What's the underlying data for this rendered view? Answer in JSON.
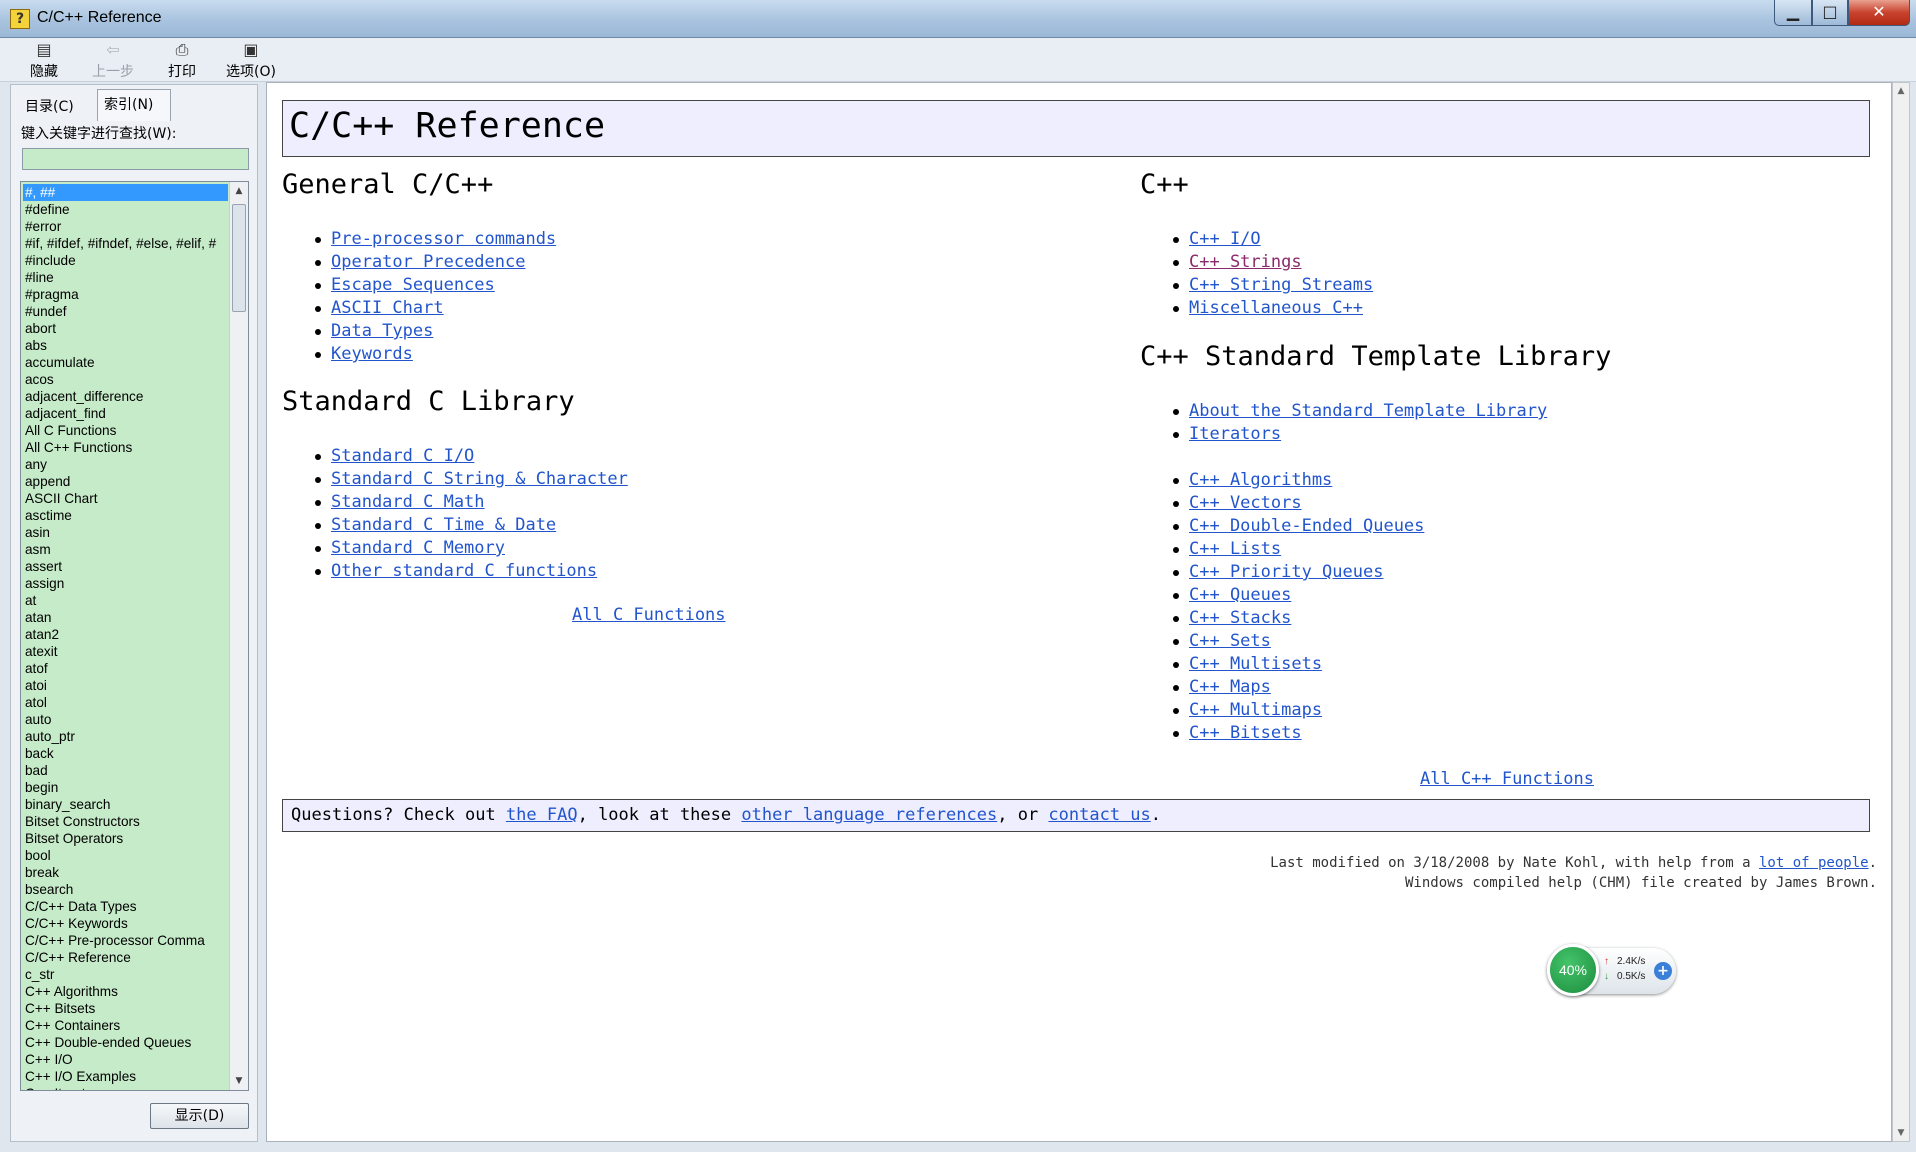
{
  "window": {
    "title": "C/C++ Reference"
  },
  "toolbar": {
    "hide": "隐藏",
    "back": "上一步",
    "print": "打印",
    "options": "选项(O)"
  },
  "sidebar": {
    "tab_contents": "目录(C)",
    "tab_index": "索引(N)",
    "search_label": "键入关键字进行查找(W):",
    "search_value": "",
    "display_button": "显示(D)",
    "keywords": [
      "#, ##",
      "#define",
      "#error",
      "#if, #ifdef, #ifndef, #else, #elif, #",
      "#include",
      "#line",
      "#pragma",
      "#undef",
      "abort",
      "abs",
      "accumulate",
      "acos",
      "adjacent_difference",
      "adjacent_find",
      "All C Functions",
      "All C++ Functions",
      "any",
      "append",
      "ASCII Chart",
      "asctime",
      "asin",
      "asm",
      "assert",
      "assign",
      "at",
      "atan",
      "atan2",
      "atexit",
      "atof",
      "atoi",
      "atol",
      "auto",
      "auto_ptr",
      "back",
      "bad",
      "begin",
      "binary_search",
      "Bitset Constructors",
      "Bitset Operators",
      "bool",
      "break",
      "bsearch",
      "C/C++ Data Types",
      "C/C++ Keywords",
      "C/C++ Pre-processor Comma",
      "C/C++ Reference",
      "c_str",
      "C++ Algorithms",
      "C++ Bitsets",
      "C++ Containers",
      "C++ Double-ended Queues",
      "C++ I/O",
      "C++ I/O Examples",
      "C++ Iterators"
    ]
  },
  "page": {
    "title": "C/C++ Reference",
    "general": {
      "heading": "General C/C++",
      "links": [
        "Pre-processor commands",
        "Operator Precedence",
        "Escape Sequences",
        "ASCII Chart",
        "Data Types",
        "Keywords"
      ]
    },
    "stdc": {
      "heading": "Standard C Library",
      "links": [
        "Standard C I/O",
        "Standard C String & Character",
        "Standard C Math",
        "Standard C Time & Date",
        "Standard C Memory",
        "Other standard C functions"
      ],
      "all_link": "All C Functions"
    },
    "cpp": {
      "heading": "C++",
      "links": [
        "C++ I/O",
        "C++ Strings",
        "C++ String Streams",
        "Miscellaneous C++"
      ]
    },
    "stl": {
      "heading": "C++ Standard Template Library",
      "links_top": [
        "About the Standard Template Library",
        "Iterators"
      ],
      "links": [
        "C++ Algorithms",
        "C++ Vectors",
        "C++ Double-Ended Queues",
        "C++ Lists",
        "C++ Priority Queues",
        "C++ Queues",
        "C++ Stacks",
        "C++ Sets",
        "C++ Multisets",
        "C++ Maps",
        "C++ Multimaps",
        "C++ Bitsets"
      ],
      "all_link": "All C++ Functions"
    },
    "footer": {
      "prefix": "Questions? Check out ",
      "faq": "the FAQ",
      "mid": ", look at these ",
      "other_refs": "other language references",
      "or": ", or ",
      "contact": "contact us",
      "end": "."
    },
    "modified_line1_prefix": "Last modified on 3/18/2008 by Nate Kohl, with help from a ",
    "modified_link": "lot of people",
    "modified_line1_end": ".",
    "modified_line2": "Windows compiled help (CHM) file created by James Brown."
  },
  "net_widget": {
    "percent": "40%",
    "up": "2.4K/s",
    "down": "0.5K/s"
  },
  "colors": {
    "list_bg": "#c6ebc9",
    "selection": "#3399ff",
    "link": "#2255cc",
    "visited_link": "#8b2a6a",
    "header_bg": "#eeeeff"
  }
}
